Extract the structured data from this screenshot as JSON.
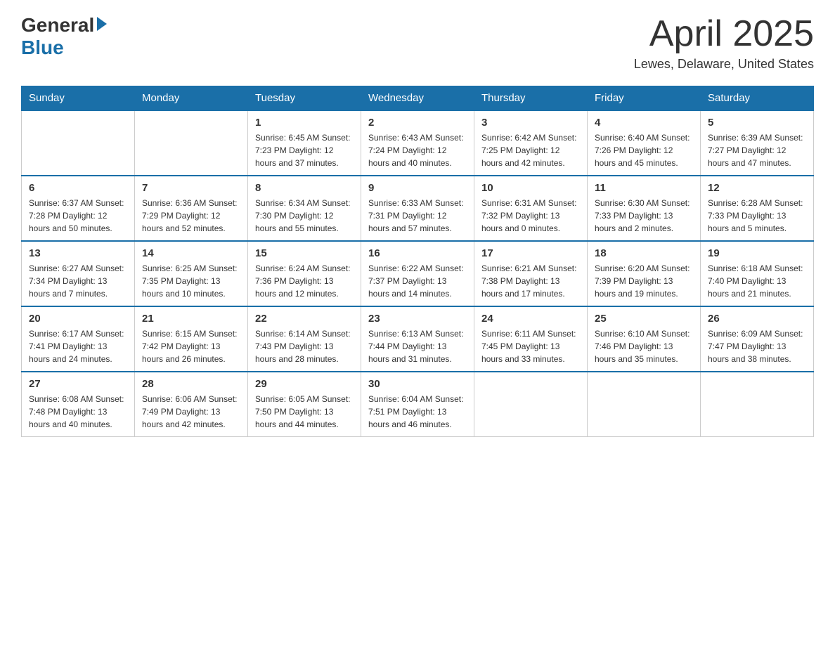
{
  "header": {
    "logo_general": "General",
    "logo_blue": "Blue",
    "month_year": "April 2025",
    "location": "Lewes, Delaware, United States"
  },
  "days_of_week": [
    "Sunday",
    "Monday",
    "Tuesday",
    "Wednesday",
    "Thursday",
    "Friday",
    "Saturday"
  ],
  "weeks": [
    [
      {
        "day": "",
        "info": ""
      },
      {
        "day": "",
        "info": ""
      },
      {
        "day": "1",
        "info": "Sunrise: 6:45 AM\nSunset: 7:23 PM\nDaylight: 12 hours\nand 37 minutes."
      },
      {
        "day": "2",
        "info": "Sunrise: 6:43 AM\nSunset: 7:24 PM\nDaylight: 12 hours\nand 40 minutes."
      },
      {
        "day": "3",
        "info": "Sunrise: 6:42 AM\nSunset: 7:25 PM\nDaylight: 12 hours\nand 42 minutes."
      },
      {
        "day": "4",
        "info": "Sunrise: 6:40 AM\nSunset: 7:26 PM\nDaylight: 12 hours\nand 45 minutes."
      },
      {
        "day": "5",
        "info": "Sunrise: 6:39 AM\nSunset: 7:27 PM\nDaylight: 12 hours\nand 47 minutes."
      }
    ],
    [
      {
        "day": "6",
        "info": "Sunrise: 6:37 AM\nSunset: 7:28 PM\nDaylight: 12 hours\nand 50 minutes."
      },
      {
        "day": "7",
        "info": "Sunrise: 6:36 AM\nSunset: 7:29 PM\nDaylight: 12 hours\nand 52 minutes."
      },
      {
        "day": "8",
        "info": "Sunrise: 6:34 AM\nSunset: 7:30 PM\nDaylight: 12 hours\nand 55 minutes."
      },
      {
        "day": "9",
        "info": "Sunrise: 6:33 AM\nSunset: 7:31 PM\nDaylight: 12 hours\nand 57 minutes."
      },
      {
        "day": "10",
        "info": "Sunrise: 6:31 AM\nSunset: 7:32 PM\nDaylight: 13 hours\nand 0 minutes."
      },
      {
        "day": "11",
        "info": "Sunrise: 6:30 AM\nSunset: 7:33 PM\nDaylight: 13 hours\nand 2 minutes."
      },
      {
        "day": "12",
        "info": "Sunrise: 6:28 AM\nSunset: 7:33 PM\nDaylight: 13 hours\nand 5 minutes."
      }
    ],
    [
      {
        "day": "13",
        "info": "Sunrise: 6:27 AM\nSunset: 7:34 PM\nDaylight: 13 hours\nand 7 minutes."
      },
      {
        "day": "14",
        "info": "Sunrise: 6:25 AM\nSunset: 7:35 PM\nDaylight: 13 hours\nand 10 minutes."
      },
      {
        "day": "15",
        "info": "Sunrise: 6:24 AM\nSunset: 7:36 PM\nDaylight: 13 hours\nand 12 minutes."
      },
      {
        "day": "16",
        "info": "Sunrise: 6:22 AM\nSunset: 7:37 PM\nDaylight: 13 hours\nand 14 minutes."
      },
      {
        "day": "17",
        "info": "Sunrise: 6:21 AM\nSunset: 7:38 PM\nDaylight: 13 hours\nand 17 minutes."
      },
      {
        "day": "18",
        "info": "Sunrise: 6:20 AM\nSunset: 7:39 PM\nDaylight: 13 hours\nand 19 minutes."
      },
      {
        "day": "19",
        "info": "Sunrise: 6:18 AM\nSunset: 7:40 PM\nDaylight: 13 hours\nand 21 minutes."
      }
    ],
    [
      {
        "day": "20",
        "info": "Sunrise: 6:17 AM\nSunset: 7:41 PM\nDaylight: 13 hours\nand 24 minutes."
      },
      {
        "day": "21",
        "info": "Sunrise: 6:15 AM\nSunset: 7:42 PM\nDaylight: 13 hours\nand 26 minutes."
      },
      {
        "day": "22",
        "info": "Sunrise: 6:14 AM\nSunset: 7:43 PM\nDaylight: 13 hours\nand 28 minutes."
      },
      {
        "day": "23",
        "info": "Sunrise: 6:13 AM\nSunset: 7:44 PM\nDaylight: 13 hours\nand 31 minutes."
      },
      {
        "day": "24",
        "info": "Sunrise: 6:11 AM\nSunset: 7:45 PM\nDaylight: 13 hours\nand 33 minutes."
      },
      {
        "day": "25",
        "info": "Sunrise: 6:10 AM\nSunset: 7:46 PM\nDaylight: 13 hours\nand 35 minutes."
      },
      {
        "day": "26",
        "info": "Sunrise: 6:09 AM\nSunset: 7:47 PM\nDaylight: 13 hours\nand 38 minutes."
      }
    ],
    [
      {
        "day": "27",
        "info": "Sunrise: 6:08 AM\nSunset: 7:48 PM\nDaylight: 13 hours\nand 40 minutes."
      },
      {
        "day": "28",
        "info": "Sunrise: 6:06 AM\nSunset: 7:49 PM\nDaylight: 13 hours\nand 42 minutes."
      },
      {
        "day": "29",
        "info": "Sunrise: 6:05 AM\nSunset: 7:50 PM\nDaylight: 13 hours\nand 44 minutes."
      },
      {
        "day": "30",
        "info": "Sunrise: 6:04 AM\nSunset: 7:51 PM\nDaylight: 13 hours\nand 46 minutes."
      },
      {
        "day": "",
        "info": ""
      },
      {
        "day": "",
        "info": ""
      },
      {
        "day": "",
        "info": ""
      }
    ]
  ]
}
